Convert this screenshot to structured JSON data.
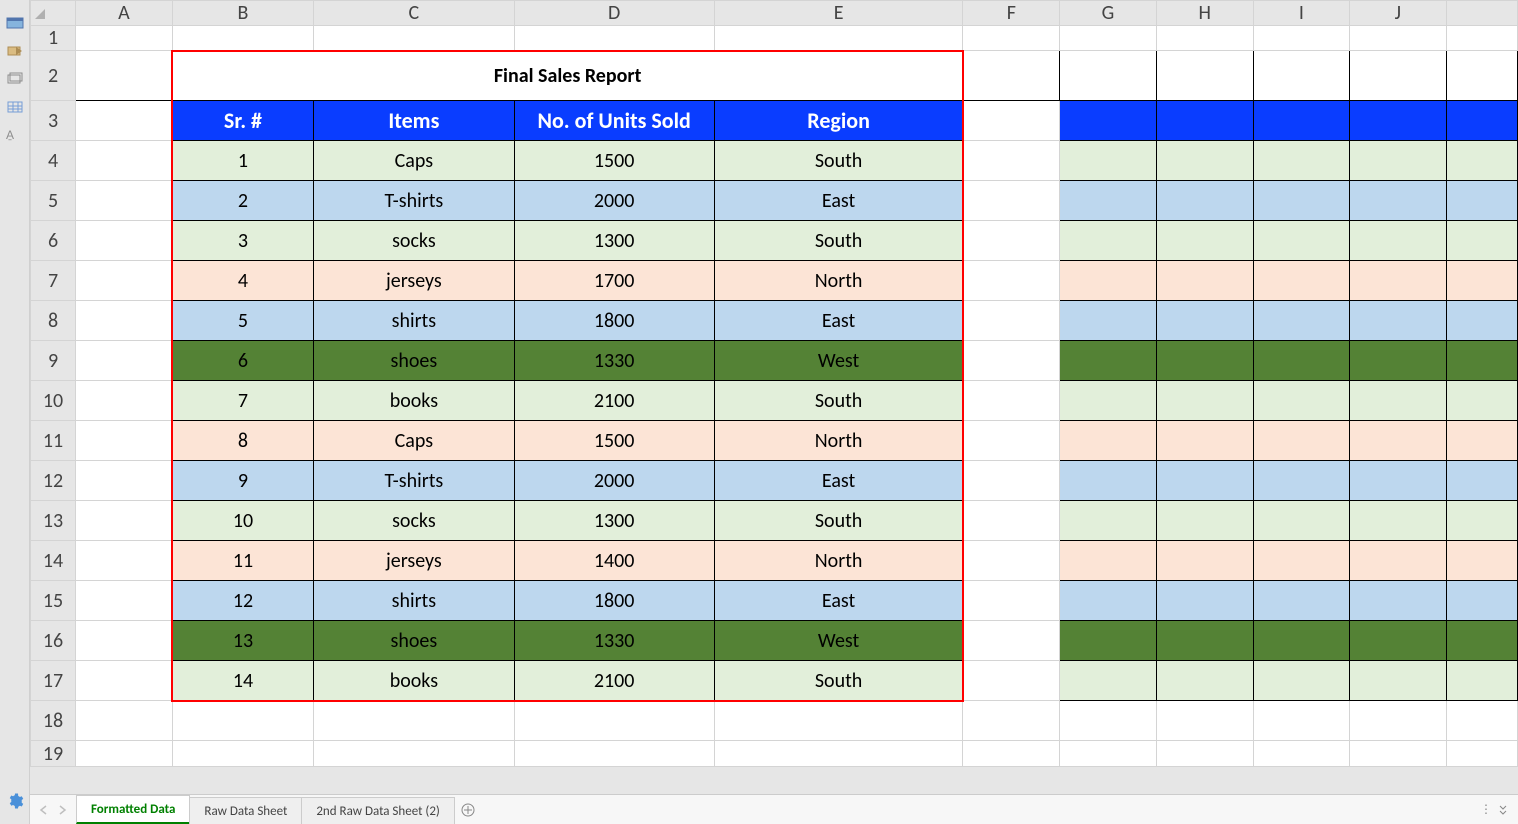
{
  "columns": [
    "A",
    "B",
    "C",
    "D",
    "E",
    "F",
    "G",
    "H",
    "I",
    "J"
  ],
  "row_labels": [
    "1",
    "2",
    "3",
    "4",
    "5",
    "6",
    "7",
    "8",
    "9",
    "10",
    "11",
    "12",
    "13",
    "14",
    "15",
    "16",
    "17",
    "18",
    "19"
  ],
  "title": "Final Sales Report",
  "headers": {
    "sr": "Sr. #",
    "items": "Items",
    "units": "No. of Units Sold",
    "region": "Region"
  },
  "rows": [
    {
      "sr": "1",
      "item": "Caps",
      "units": "1500",
      "region": "South",
      "style": "lightgreen"
    },
    {
      "sr": "2",
      "item": "T-shirts",
      "units": "2000",
      "region": "East",
      "style": "lightblue"
    },
    {
      "sr": "3",
      "item": "socks",
      "units": "1300",
      "region": "South",
      "style": "lightgreen"
    },
    {
      "sr": "4",
      "item": "jerseys",
      "units": "1700",
      "region": "North",
      "style": "lightpeach"
    },
    {
      "sr": "5",
      "item": "shirts",
      "units": "1800",
      "region": "East",
      "style": "lightblue"
    },
    {
      "sr": "6",
      "item": "shoes",
      "units": "1330",
      "region": "West",
      "style": "darkgreen"
    },
    {
      "sr": "7",
      "item": "books",
      "units": "2100",
      "region": "South",
      "style": "lightgreen"
    },
    {
      "sr": "8",
      "item": "Caps",
      "units": "1500",
      "region": "North",
      "style": "lightpeach"
    },
    {
      "sr": "9",
      "item": "T-shirts",
      "units": "2000",
      "region": "East",
      "style": "lightblue"
    },
    {
      "sr": "10",
      "item": "socks",
      "units": "1300",
      "region": "South",
      "style": "lightgreen"
    },
    {
      "sr": "11",
      "item": "jerseys",
      "units": "1400",
      "region": "North",
      "style": "lightpeach"
    },
    {
      "sr": "12",
      "item": "shirts",
      "units": "1800",
      "region": "East",
      "style": "lightblue"
    },
    {
      "sr": "13",
      "item": "shoes",
      "units": "1330",
      "region": "West",
      "style": "darkgreen"
    },
    {
      "sr": "14",
      "item": "books",
      "units": "2100",
      "region": "South",
      "style": "lightgreen"
    }
  ],
  "tabs": [
    {
      "label": "Formatted Data",
      "active": true
    },
    {
      "label": "Raw Data Sheet",
      "active": false
    },
    {
      "label": "2nd Raw Data Sheet  (2)",
      "active": false
    }
  ],
  "footer_right": "⋮",
  "chart_data": {
    "type": "table",
    "title": "Final Sales Report",
    "columns": [
      "Sr. #",
      "Items",
      "No. of Units Sold",
      "Region"
    ],
    "rows": [
      [
        1,
        "Caps",
        1500,
        "South"
      ],
      [
        2,
        "T-shirts",
        2000,
        "East"
      ],
      [
        3,
        "socks",
        1300,
        "South"
      ],
      [
        4,
        "jerseys",
        1700,
        "North"
      ],
      [
        5,
        "shirts",
        1800,
        "East"
      ],
      [
        6,
        "shoes",
        1330,
        "West"
      ],
      [
        7,
        "books",
        2100,
        "South"
      ],
      [
        8,
        "Caps",
        1500,
        "North"
      ],
      [
        9,
        "T-shirts",
        2000,
        "East"
      ],
      [
        10,
        "socks",
        1300,
        "South"
      ],
      [
        11,
        "jerseys",
        1400,
        "North"
      ],
      [
        12,
        "shirts",
        1800,
        "East"
      ],
      [
        13,
        "shoes",
        1330,
        "West"
      ],
      [
        14,
        "books",
        2100,
        "South"
      ]
    ]
  }
}
